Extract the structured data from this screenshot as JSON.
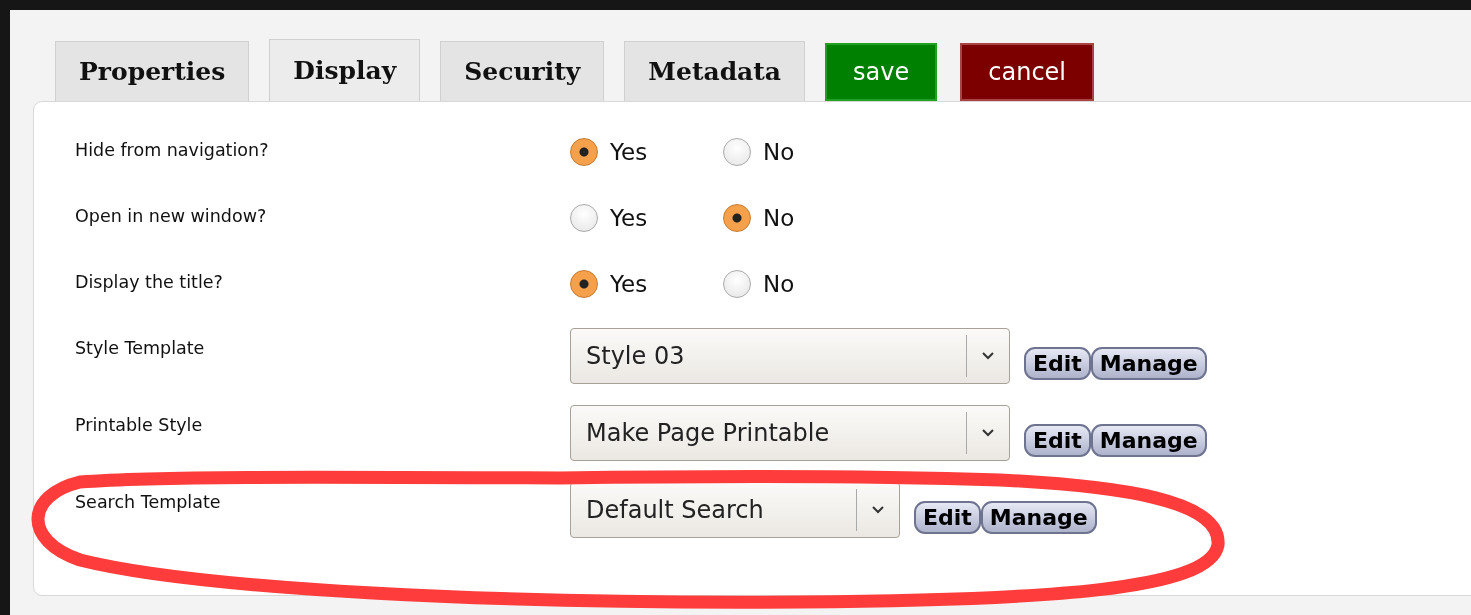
{
  "tabs": [
    {
      "label": "Properties",
      "selected": false
    },
    {
      "label": "Display",
      "selected": true
    },
    {
      "label": "Security",
      "selected": false
    },
    {
      "label": "Metadata",
      "selected": false
    }
  ],
  "actions": [
    {
      "label": "save",
      "kind": "save"
    },
    {
      "label": "cancel",
      "kind": "cancel"
    }
  ],
  "rows": [
    {
      "kind": "radio",
      "label": "Hide from navigation?",
      "options": [
        {
          "label": "Yes",
          "selected": true
        },
        {
          "label": "No",
          "selected": false
        }
      ]
    },
    {
      "kind": "radio",
      "label": "Open in new window?",
      "options": [
        {
          "label": "Yes",
          "selected": false
        },
        {
          "label": "No",
          "selected": true
        }
      ]
    },
    {
      "kind": "radio",
      "label": "Display the title?",
      "options": [
        {
          "label": "Yes",
          "selected": true
        },
        {
          "label": "No",
          "selected": false
        }
      ]
    },
    {
      "kind": "select",
      "label": "Style Template",
      "value": "Style 03",
      "buttons": [
        "Edit",
        "Manage"
      ]
    },
    {
      "kind": "select",
      "label": "Printable Style",
      "value": "Make Page Printable",
      "buttons": [
        "Edit",
        "Manage"
      ]
    },
    {
      "kind": "select",
      "label": "Search Template",
      "value": "Default Search",
      "buttons": [
        "Edit",
        "Manage"
      ]
    }
  ]
}
